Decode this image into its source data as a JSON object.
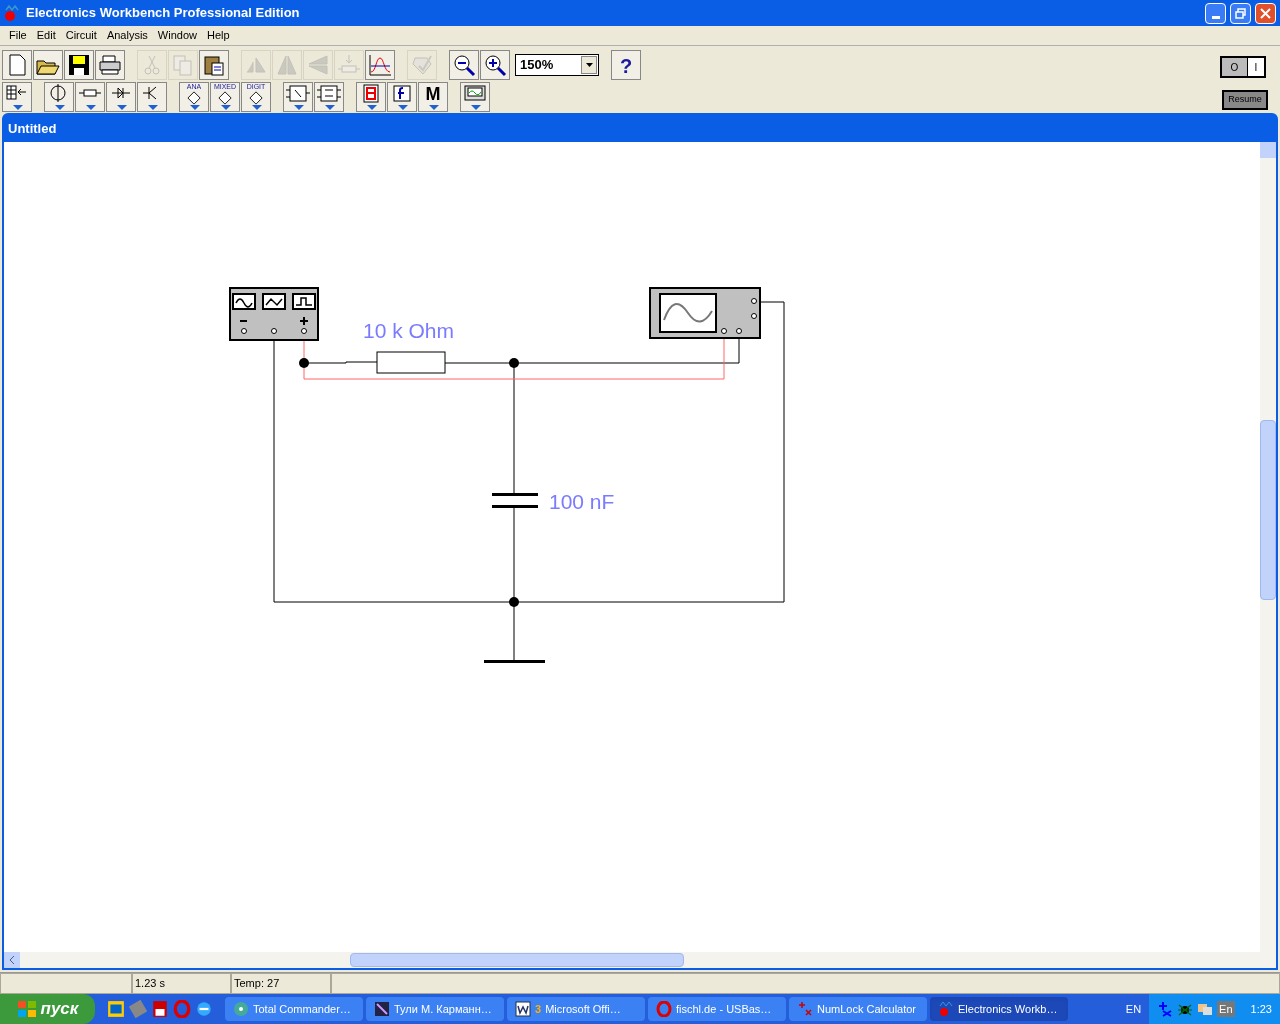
{
  "window": {
    "title": "Electronics Workbench Professional Edition"
  },
  "menu": [
    "File",
    "Edit",
    "Circuit",
    "Analysis",
    "Window",
    "Help"
  ],
  "toolbar": [
    {
      "kind": "new",
      "disabled": false
    },
    {
      "kind": "open",
      "disabled": false
    },
    {
      "kind": "save",
      "disabled": false
    },
    {
      "kind": "print",
      "disabled": false
    },
    {
      "kind": "sep"
    },
    {
      "kind": "cut",
      "disabled": true
    },
    {
      "kind": "copy",
      "disabled": true
    },
    {
      "kind": "paste",
      "disabled": false
    },
    {
      "kind": "sep"
    },
    {
      "kind": "rotate",
      "disabled": true
    },
    {
      "kind": "flip-h",
      "disabled": true
    },
    {
      "kind": "flip-v",
      "disabled": true
    },
    {
      "kind": "properties",
      "disabled": true
    },
    {
      "kind": "graph",
      "disabled": false
    },
    {
      "kind": "sep"
    },
    {
      "kind": "check",
      "disabled": true
    },
    {
      "kind": "sep"
    },
    {
      "kind": "zoom-out",
      "disabled": false
    },
    {
      "kind": "zoom-in",
      "disabled": false
    }
  ],
  "zoom": {
    "value": "150%"
  },
  "help_button": "?",
  "parts_bin": [
    {
      "kind": "favorites"
    },
    {
      "kind": "sep"
    },
    {
      "kind": "source"
    },
    {
      "kind": "resistor"
    },
    {
      "kind": "diode"
    },
    {
      "kind": "transistor"
    },
    {
      "kind": "sep"
    },
    {
      "kind": "ic",
      "label": "ANA"
    },
    {
      "kind": "ic",
      "label": "MIXED"
    },
    {
      "kind": "ic",
      "label": "DIGIT"
    },
    {
      "kind": "sep"
    },
    {
      "kind": "logic"
    },
    {
      "kind": "flipflop"
    },
    {
      "kind": "sep"
    },
    {
      "kind": "display"
    },
    {
      "kind": "function"
    },
    {
      "kind": "text",
      "label": "M"
    },
    {
      "kind": "sep"
    },
    {
      "kind": "instrument"
    }
  ],
  "power_switch": {
    "off_label": "O",
    "on_label": "I",
    "on": false
  },
  "resume_button": "Resume",
  "document": {
    "title": "Untitled"
  },
  "circuit": {
    "resistor_label": "10 k Ohm",
    "capacitor_label": "100 nF"
  },
  "status_bar": {
    "time": "1.23 s",
    "temperature": "Temp:  27"
  },
  "taskbar": {
    "start": "пуск",
    "tasks": [
      {
        "label": "Total Commander…",
        "selected": false
      },
      {
        "label": "Тули М. Карманн…",
        "selected": false
      },
      {
        "count": "3",
        "label": "Microsoft Offi…",
        "selected": false
      },
      {
        "label": "fischl.de - USBas…",
        "selected": false
      },
      {
        "label": "NumLock Calculator",
        "selected": false
      },
      {
        "label": "Electronics Workb…",
        "selected": true
      }
    ],
    "language": "EN",
    "tray_language": "En",
    "clock": "1:23"
  }
}
